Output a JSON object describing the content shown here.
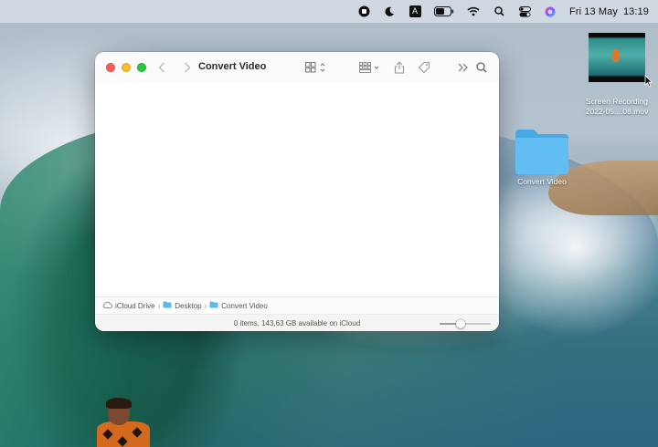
{
  "menubar": {
    "icons": [
      "record-icon",
      "moon-icon",
      "input-source-icon",
      "battery-icon",
      "wifi-icon",
      "search-icon",
      "control-center-icon",
      "siri-icon"
    ],
    "input_source": "A",
    "date": "Fri 13 May",
    "time": "13:19"
  },
  "window": {
    "title": "Convert Video",
    "toolbar_icons": [
      "back-icon",
      "forward-icon",
      "view-icon",
      "group-icon",
      "share-icon",
      "tag-icon",
      "more-icon",
      "search-icon"
    ],
    "path": {
      "items": [
        "iCloud Drive",
        "Desktop",
        "Convert Video"
      ]
    },
    "status": "0 items, 143,63 GB available on iCloud",
    "icon_size_slider": 0.4
  },
  "desktop": {
    "recording": {
      "line1": "Screen Recording",
      "line2": "2022-05....08.mov"
    },
    "folder": {
      "label": "Convert Video"
    }
  },
  "colors": {
    "folder_blue": "#5db8f0",
    "traffic_red": "#fe5f57",
    "traffic_yellow": "#febc2e",
    "traffic_green": "#28c840"
  }
}
